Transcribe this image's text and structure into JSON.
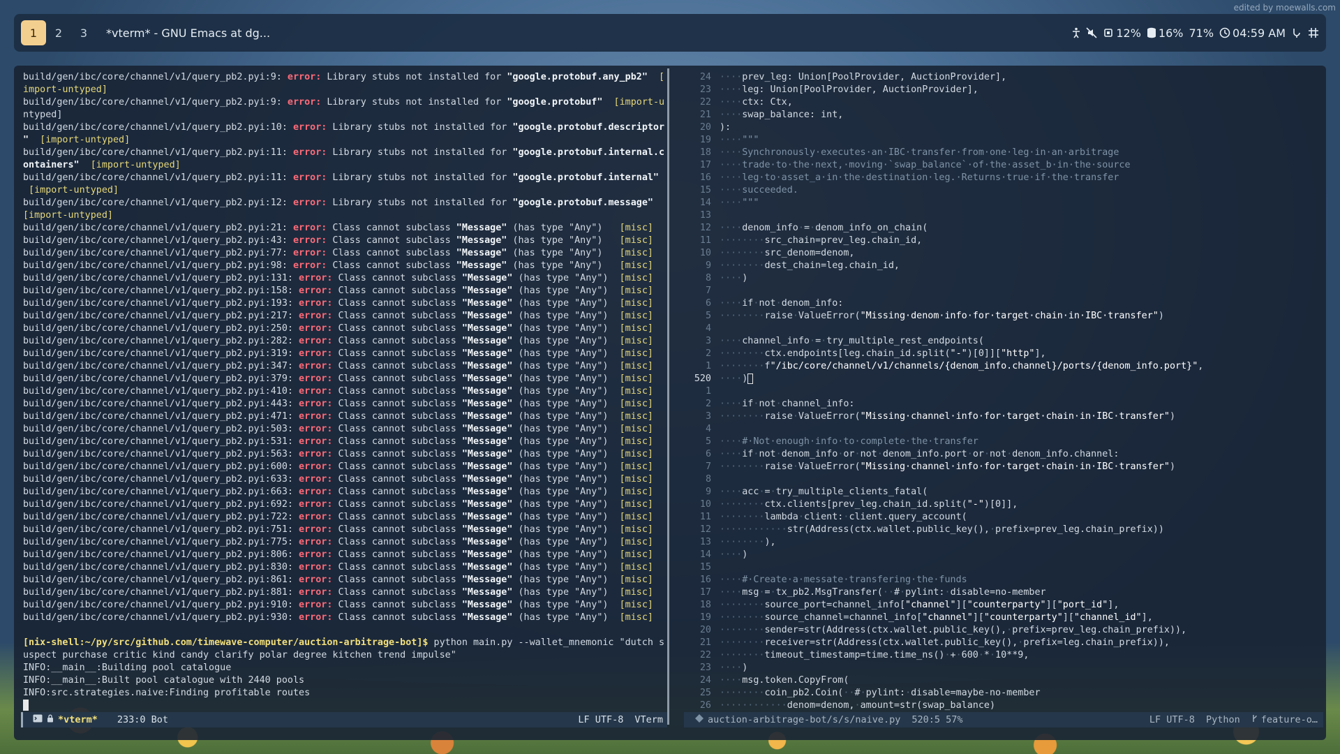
{
  "watermark": "edited by moewalls.com",
  "topbar": {
    "workspaces": [
      "1",
      "2",
      "3"
    ],
    "active_workspace": "1",
    "window_title": "*vterm* - GNU Emacs at dg...",
    "tray": {
      "cpu": "12%",
      "disk": "16%",
      "battery": "71%",
      "clock": "04:59 AM"
    }
  },
  "left_pane": {
    "lines": [
      [
        "build/gen/ibc/core/channel/v1/query_pb2.pyi:9: ",
        "error:",
        " Library stubs not installed for ",
        "\"google.protobuf.any_pb2\"",
        "  ["
      ],
      [
        "import-untyped]"
      ],
      [
        "build/gen/ibc/core/channel/v1/query_pb2.pyi:9: ",
        "error:",
        " Library stubs not installed for ",
        "\"google.protobuf\"",
        "  [import-u"
      ],
      [
        "ntyped]"
      ],
      [
        "build/gen/ibc/core/channel/v1/query_pb2.pyi:10: ",
        "error:",
        " Library stubs not installed for ",
        "\"google.protobuf.descriptor",
        ""
      ],
      [
        "\"",
        "",
        "  [import-untyped]"
      ],
      [
        "build/gen/ibc/core/channel/v1/query_pb2.pyi:11: ",
        "error:",
        " Library stubs not installed for ",
        "\"google.protobuf.internal.c",
        ""
      ],
      [
        "ontainers\"",
        "",
        "  [import-untyped]"
      ],
      [
        "build/gen/ibc/core/channel/v1/query_pb2.pyi:11: ",
        "error:",
        " Library stubs not installed for ",
        "\"google.protobuf.internal\"",
        ""
      ],
      [
        " [import-untyped]"
      ],
      [
        "build/gen/ibc/core/channel/v1/query_pb2.pyi:12: ",
        "error:",
        " Library stubs not installed for ",
        "\"google.protobuf.message\"",
        ""
      ],
      [
        "[import-untyped]"
      ]
    ],
    "message_errors": [
      [
        "21",
        "  "
      ],
      [
        "43",
        "  "
      ],
      [
        "77",
        "  "
      ],
      [
        "98",
        "  "
      ],
      [
        "131",
        " "
      ],
      [
        "158",
        " "
      ],
      [
        "193",
        " "
      ],
      [
        "217",
        " "
      ],
      [
        "250",
        " "
      ],
      [
        "282",
        " "
      ],
      [
        "319",
        " "
      ],
      [
        "347",
        " "
      ],
      [
        "379",
        " "
      ],
      [
        "410",
        " "
      ],
      [
        "443",
        " "
      ],
      [
        "471",
        " "
      ],
      [
        "503",
        " "
      ],
      [
        "531",
        " "
      ],
      [
        "563",
        " "
      ],
      [
        "600",
        " "
      ],
      [
        "633",
        " "
      ],
      [
        "663",
        " "
      ],
      [
        "692",
        " "
      ],
      [
        "722",
        " "
      ],
      [
        "751",
        " "
      ],
      [
        "775",
        " "
      ],
      [
        "806",
        " "
      ],
      [
        "830",
        " "
      ],
      [
        "861",
        " "
      ],
      [
        "881",
        " "
      ],
      [
        "910",
        " "
      ],
      [
        "930",
        " "
      ]
    ],
    "error_prefix": "build/gen/ibc/core/channel/v1/query_pb2.pyi:",
    "error_word": "error:",
    "error_msg_a": " Class cannot subclass ",
    "error_msg_q": "\"Message\"",
    "error_msg_b": " (has type \"Any\") ",
    "error_tag": "[misc]",
    "prompt": "[nix-shell:~/py/src/github.com/timewave-computer/auction-arbitrage-bot]$",
    "command_1": " python main.py --wallet_mnemonic \"dutch s",
    "command_2": "uspect purchase critic kind candy clarify polar degree kitchen trend impulse\"",
    "info": [
      "INFO:__main__:Building pool catalogue",
      "INFO:__main__:Built pool catalogue with 2440 pools",
      "INFO:src.strategies.naive:Finding profitable routes"
    ]
  },
  "left_modeline": {
    "buffer": "*vterm*",
    "position": "233:0 Bot",
    "encoding": "LF UTF-8",
    "mode": "VTerm"
  },
  "right_pane": {
    "lines": [
      {
        "n": "24",
        "t": "····prev_leg: Union[PoolProvider, AuctionProvider],"
      },
      {
        "n": "23",
        "t": "····leg: Union[PoolProvider, AuctionProvider],"
      },
      {
        "n": "22",
        "t": "····ctx: Ctx,"
      },
      {
        "n": "21",
        "t": "····swap_balance: int,"
      },
      {
        "n": "20",
        "t": "):"
      },
      {
        "n": "19",
        "t": "····\"\"\"",
        "c": "cm"
      },
      {
        "n": "18",
        "t": "····Synchronously·executes·an·IBC·transfer·from·one·leg·in·an·arbitrage",
        "c": "cm"
      },
      {
        "n": "17",
        "t": "····trade·to·the·next,·moving·`swap_balance`·of·the·asset_b·in·the·source",
        "c": "cm"
      },
      {
        "n": "16",
        "t": "····leg·to·asset_a·in·the·destination·leg.·Returns·true·if·the·transfer",
        "c": "cm"
      },
      {
        "n": "15",
        "t": "····succeeded.",
        "c": "cm"
      },
      {
        "n": "14",
        "t": "····\"\"\"",
        "c": "cm"
      },
      {
        "n": "13",
        "t": ""
      },
      {
        "n": "12",
        "t": "····denom_info·=·denom_info_on_chain("
      },
      {
        "n": "11",
        "t": "········src_chain=prev_leg.chain_id,"
      },
      {
        "n": "10",
        "t": "········src_denom=denom,"
      },
      {
        "n": "9",
        "t": "········dest_chain=leg.chain_id,"
      },
      {
        "n": "8",
        "t": "····)"
      },
      {
        "n": "7",
        "t": ""
      },
      {
        "n": "6",
        "t": "····if·not·denom_info:"
      },
      {
        "n": "5",
        "t": "········raise·ValueError(\"Missing·denom·info·for·target·chain·in·IBC·transfer\")"
      },
      {
        "n": "4",
        "t": ""
      },
      {
        "n": "3",
        "t": "····channel_info·=·try_multiple_rest_endpoints("
      },
      {
        "n": "2",
        "t": "········ctx.endpoints[leg.chain_id.split(\"-\")[0]][\"http\"],"
      },
      {
        "n": "1",
        "t": "········f\"/ibc/core/channel/v1/channels/{denom_info.channel}/ports/{denom_info.port}\","
      },
      {
        "n": "520",
        "t": "····)",
        "cur": true
      },
      {
        "n": "1",
        "t": ""
      },
      {
        "n": "2",
        "t": "····if·not·channel_info:"
      },
      {
        "n": "3",
        "t": "········raise·ValueError(\"Missing·channel·info·for·target·chain·in·IBC·transfer\")"
      },
      {
        "n": "4",
        "t": ""
      },
      {
        "n": "5",
        "t": "····#·Not·enough·info·to·complete·the·transfer",
        "c": "cm"
      },
      {
        "n": "6",
        "t": "····if·not·denom_info·or·not·denom_info.port·or·not·denom_info.channel:"
      },
      {
        "n": "7",
        "t": "········raise·ValueError(\"Missing·channel·info·for·target·chain·in·IBC·transfer\")"
      },
      {
        "n": "8",
        "t": ""
      },
      {
        "n": "9",
        "t": "····acc·=·try_multiple_clients_fatal("
      },
      {
        "n": "10",
        "t": "········ctx.clients[prev_leg.chain_id.split(\"-\")[0]],"
      },
      {
        "n": "11",
        "t": "········lambda·client:·client.query_account("
      },
      {
        "n": "12",
        "t": "············str(Address(ctx.wallet.public_key(),·prefix=prev_leg.chain_prefix))"
      },
      {
        "n": "13",
        "t": "········),"
      },
      {
        "n": "14",
        "t": "····)"
      },
      {
        "n": "15",
        "t": ""
      },
      {
        "n": "16",
        "t": "····#·Create·a·messate·transfering·the·funds",
        "c": "cm"
      },
      {
        "n": "17",
        "t": "····msg·=·tx_pb2.MsgTransfer(··#·pylint:·disable=no-member"
      },
      {
        "n": "18",
        "t": "········source_port=channel_info[\"channel\"][\"counterparty\"][\"port_id\"],"
      },
      {
        "n": "19",
        "t": "········source_channel=channel_info[\"channel\"][\"counterparty\"][\"channel_id\"],"
      },
      {
        "n": "20",
        "t": "········sender=str(Address(ctx.wallet.public_key(),·prefix=prev_leg.chain_prefix)),"
      },
      {
        "n": "21",
        "t": "········receiver=str(Address(ctx.wallet.public_key(),·prefix=leg.chain_prefix)),"
      },
      {
        "n": "22",
        "t": "········timeout_timestamp=time.time_ns()·+·600·*·10**9,"
      },
      {
        "n": "23",
        "t": "····)"
      },
      {
        "n": "24",
        "t": "····msg.token.CopyFrom("
      },
      {
        "n": "25",
        "t": "········coin_pb2.Coin(··#·pylint:·disable=maybe-no-member"
      },
      {
        "n": "26",
        "t": "············denom=denom,·amount=str(swap_balance)"
      }
    ]
  },
  "right_modeline": {
    "path": "auction-arbitrage-bot/s/s/naive.py",
    "position": "520:5 57%",
    "encoding": "LF UTF-8",
    "mode": "Python",
    "branch": "feature-o…"
  }
}
